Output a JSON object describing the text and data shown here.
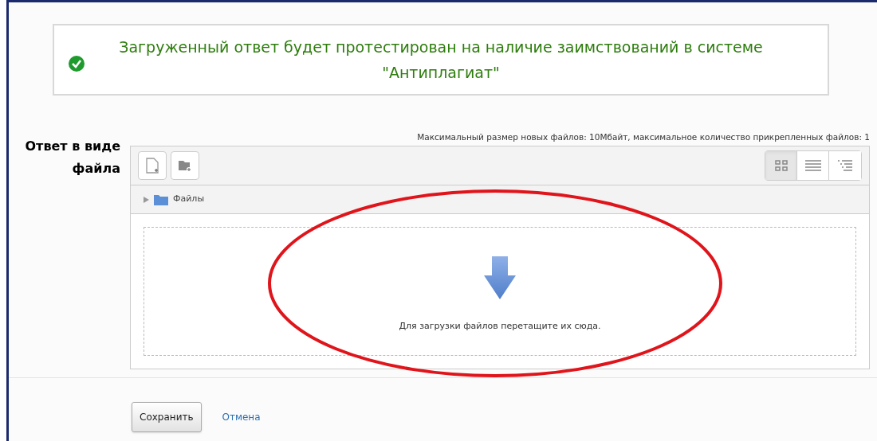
{
  "notice": {
    "text": "Загруженный ответ будет протестирован на наличие заимствований в системе \"Антиплагиат\""
  },
  "field": {
    "label": "Ответ в виде файла",
    "limits": "Максимальный размер новых файлов: 10Мбайт, максимальное количество прикрепленных файлов: 1",
    "view_modes": [
      {
        "kind": "icons",
        "selected": true
      },
      {
        "kind": "list",
        "selected": false
      },
      {
        "kind": "tree",
        "selected": false
      }
    ],
    "path": {
      "folder": "Файлы"
    },
    "dropzone": {
      "text": "Для загрузки файлов перетащите их сюда."
    }
  },
  "buttons": {
    "save": "Сохранить",
    "cancel": "Отмена"
  }
}
